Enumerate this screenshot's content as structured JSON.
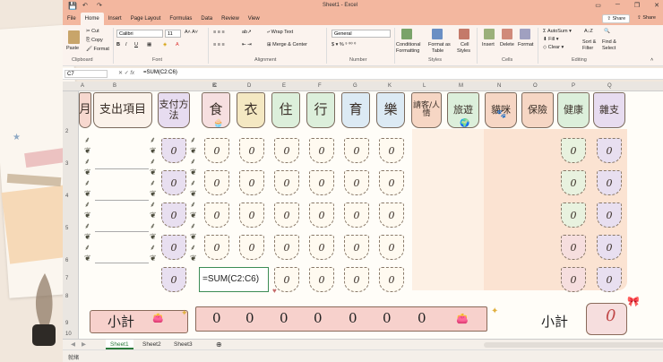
{
  "window": {
    "title": "Sheet1 - Excel",
    "share_label": "Share"
  },
  "tabs": [
    "File",
    "Home",
    "Insert",
    "Page Layout",
    "Formulas",
    "Data",
    "Review",
    "View"
  ],
  "ribbon": {
    "paste": "Paste",
    "cut": "Cut",
    "copy": "Copy",
    "format": "Format",
    "clipboard": "Clipboard",
    "font_name": "Calibri",
    "font_size": "11",
    "font_group": "Font",
    "wrap_text": "Wrap Text",
    "merge_center": "Merge & Center",
    "alignment": "Alignment",
    "number_format": "General",
    "number": "Number",
    "conditional": "Conditional",
    "formatting": "Formatting",
    "format_as": "Format as",
    "table": "Table",
    "cell": "Cell",
    "styles_btn": "Styles",
    "styles": "Styles",
    "insert": "Insert",
    "delete": "Delete",
    "format_cells": "Format",
    "cells": "Cells",
    "autosum": "AutoSum",
    "fill": "Fill",
    "clear": "Clear",
    "sort": "Sort &",
    "filter": "Filter",
    "find": "Find &",
    "select": "Select",
    "editing": "Editing"
  },
  "formula_bar": {
    "name_box": "C7",
    "fx": "fx",
    "formula": "=SUM(C2:C6)"
  },
  "columns": [
    "A",
    "B",
    "C",
    "D",
    "E",
    "F",
    "G",
    "K",
    "L",
    "M",
    "N",
    "O",
    "P",
    "Q"
  ],
  "rows": [
    "1",
    "2",
    "3",
    "4",
    "5",
    "6",
    "7",
    "8",
    "9",
    "10"
  ],
  "headers": {
    "a": "月",
    "b": "支出項目",
    "c": "支付方法",
    "food": "食",
    "cloth": "衣",
    "live": "住",
    "move": "行",
    "edu": "育",
    "fun": "樂",
    "guest": "請客/人情",
    "travel": "旅遊",
    "cat": "貓咪",
    "ins": "保險",
    "health": "健康",
    "misc": "雜支"
  },
  "cell_value": "0",
  "editing_formula": "=SUM(C2:C6)",
  "subtotal_label": "小計",
  "subtotal_values": [
    "0",
    "0",
    "0",
    "0",
    "0",
    "0",
    "0",
    "0"
  ],
  "total_label": "小計",
  "total_value": "0",
  "sheets": [
    "Sheet1",
    "Sheet2",
    "Sheet3"
  ],
  "status": "就緒"
}
